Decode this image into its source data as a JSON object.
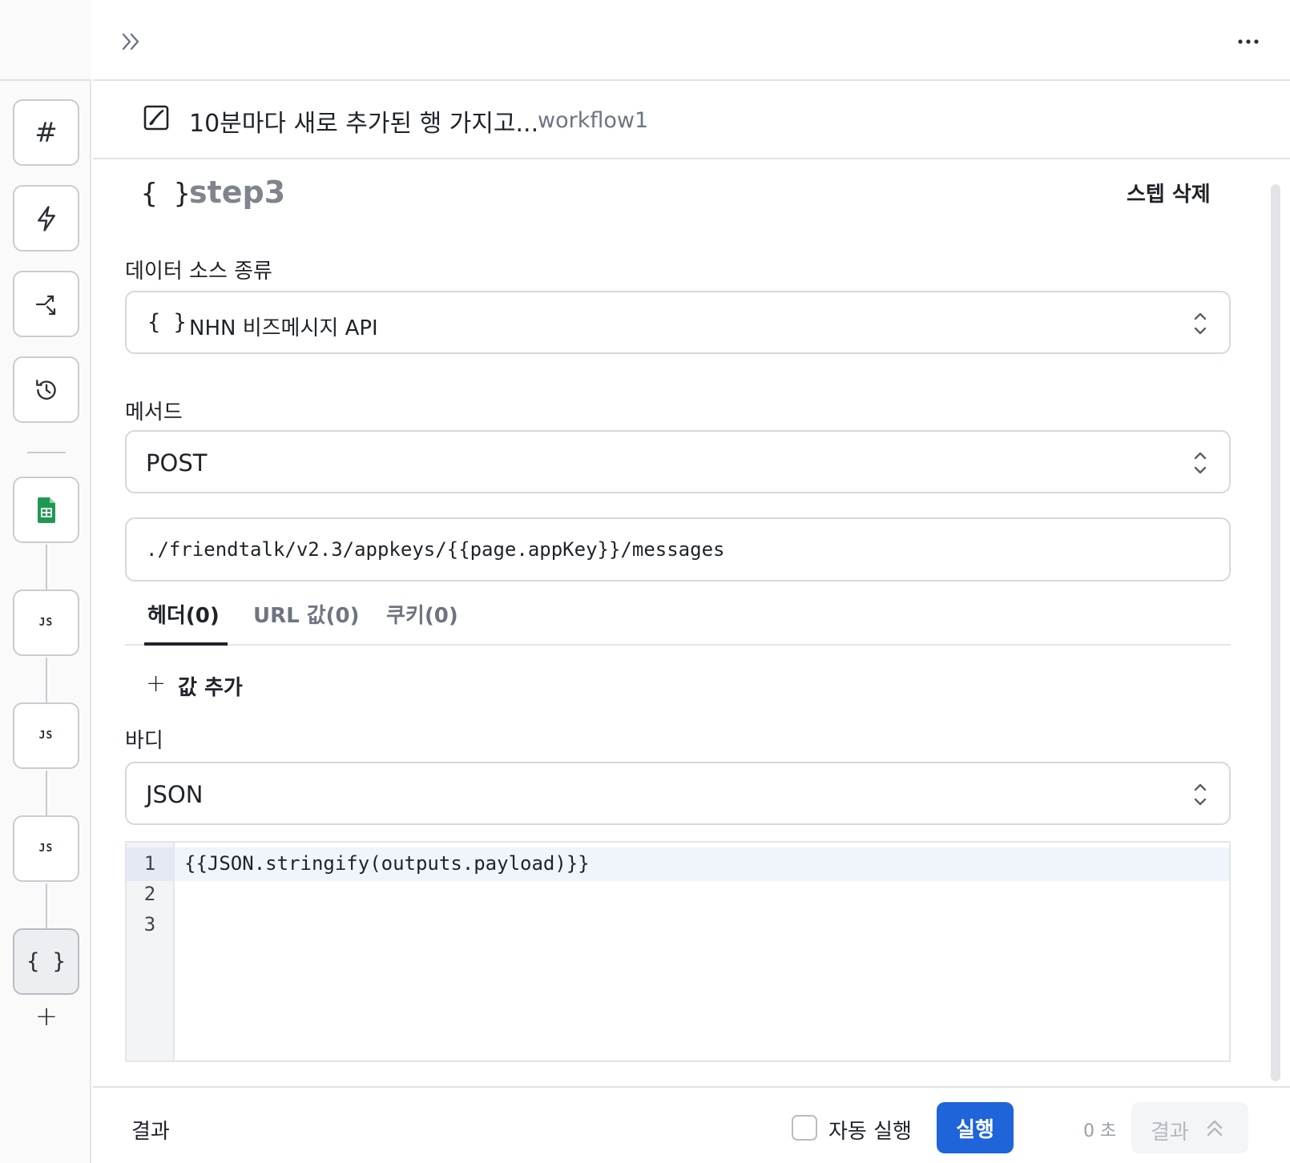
{
  "topbar": {
    "expand_icon": "double-chevron-right-icon",
    "more_icon": "ellipsis-icon"
  },
  "rail": {
    "buttons": [
      {
        "icon": "hash-icon",
        "glyph": "#"
      },
      {
        "icon": "lightning-icon"
      },
      {
        "icon": "branch-arrow-icon"
      },
      {
        "icon": "history-icon"
      },
      {
        "icon": "google-sheets-icon"
      },
      {
        "icon": "js-step-icon",
        "label": "JS"
      },
      {
        "icon": "js-step-icon",
        "label": "JS"
      },
      {
        "icon": "js-step-icon",
        "label": "JS"
      },
      {
        "icon": "braces-icon",
        "label": "{ }"
      }
    ],
    "add_label": "+"
  },
  "workflow": {
    "title": "10분마다 새로 추가된 행 가지고...",
    "name": "workflow1"
  },
  "step": {
    "braces": "{ }",
    "name": "step3",
    "delete_label": "스텝 삭제"
  },
  "data_source": {
    "label": "데이터 소스 종류",
    "braces": "{ }",
    "value": "NHN 비즈메시지 API"
  },
  "method": {
    "label": "메서드",
    "value": "POST"
  },
  "url": {
    "value": "./friendtalk/v2.3/appkeys/{{page.appKey}}/messages"
  },
  "tabs": [
    {
      "label": "헤더(0)",
      "active": true
    },
    {
      "label": "URL 값(0)",
      "active": false
    },
    {
      "label": "쿠키(0)",
      "active": false
    }
  ],
  "add_value": {
    "plus": "+",
    "label": "값 추가"
  },
  "body": {
    "label": "바디",
    "value": "JSON"
  },
  "editor": {
    "line_numbers": [
      "1",
      "2",
      "3"
    ],
    "lines": [
      "{{JSON.stringify(outputs.payload)}}",
      "",
      ""
    ]
  },
  "footer": {
    "result_label": "결과",
    "auto_run_label": "자동 실행",
    "auto_run_checked": false,
    "run_label": "실행",
    "time": "0 초",
    "result_button_label": "결과"
  },
  "colors": {
    "primary": "#1f64d8",
    "border": "#d5d8dc",
    "muted": "#6e7480"
  }
}
